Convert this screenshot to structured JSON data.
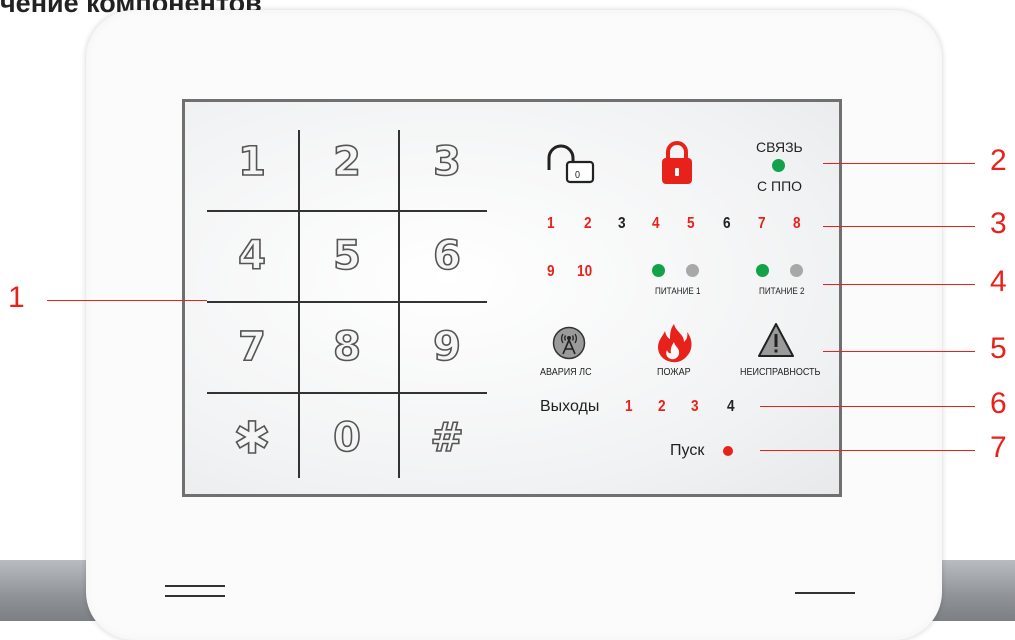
{
  "page_title": "чение компонентов",
  "keypad": {
    "keys": [
      "1",
      "2",
      "3",
      "4",
      "5",
      "6",
      "7",
      "8",
      "9",
      "✱",
      "0",
      "#"
    ]
  },
  "status": {
    "svyaz_top": "СВЯЗЬ",
    "svyaz_bottom": "С ППО",
    "zones_row1": [
      "1",
      "2",
      "3",
      "4",
      "5",
      "6",
      "7",
      "8"
    ],
    "zones_row2": [
      "9",
      "10"
    ],
    "power1_label": "ПИТАНИЕ 1",
    "power2_label": "ПИТАНИЕ 2",
    "alarm_ls_label": "АВАРИЯ ЛС",
    "fire_label": "ПОЖАР",
    "fault_label": "НЕИСПРАВНОСТЬ",
    "outputs_label": "Выходы",
    "outputs": [
      "1",
      "2",
      "3",
      "4"
    ],
    "start_label": "Пуск",
    "lock_digit": "0"
  },
  "callouts": [
    "1",
    "2",
    "3",
    "4",
    "5",
    "6",
    "7"
  ],
  "colors": {
    "red": "#e8221b",
    "green": "#12a24a",
    "grey_led": "#a8a8a8",
    "frame": "#707070"
  },
  "icons": {
    "unlock": "padlock-open-icon",
    "lock": "padlock-closed-icon",
    "antenna": "antenna-alarm-icon",
    "fire": "flame-icon",
    "fault": "warning-triangle-icon"
  }
}
